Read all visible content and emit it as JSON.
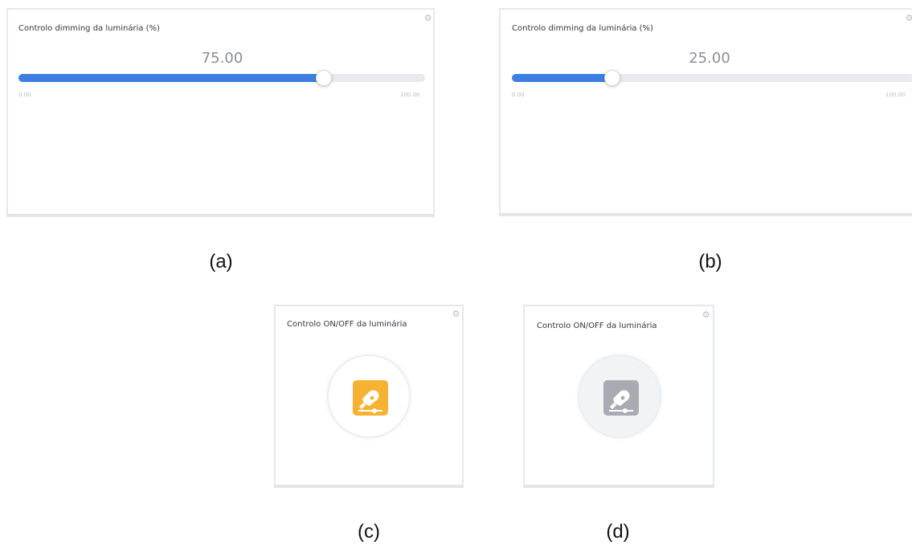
{
  "colors": {
    "slider_fill": "#3d7fe0",
    "track": "#e8eaed",
    "on_icon": "#f5b233",
    "off_icon": "#a8abb1",
    "off_ring_bg": "#f2f3f5"
  },
  "panels": [
    {
      "id": "a",
      "title": "Controlo dimming da luminária (%)",
      "value_display": "75.00",
      "value": 75,
      "min_label": "0.00",
      "max_label": "100.00",
      "min": 0,
      "max": 100,
      "caption": "(a)",
      "icon": "gear-icon"
    },
    {
      "id": "b",
      "title": "Controlo dimming da luminária (%)",
      "value_display": "25.00",
      "value": 25,
      "min_label": "0.00",
      "max_label": "100.00",
      "min": 0,
      "max": 100,
      "caption": "(b)",
      "icon": "gear-icon"
    }
  ],
  "toggles": [
    {
      "id": "c",
      "title": "Controlo ON/OFF da luminária",
      "state": "on",
      "caption": "(c)",
      "icon": "lamp-dimmer-icon"
    },
    {
      "id": "d",
      "title": "Controlo ON/OFF da luminária",
      "state": "off",
      "caption": "(d)",
      "icon": "lamp-dimmer-icon"
    }
  ]
}
